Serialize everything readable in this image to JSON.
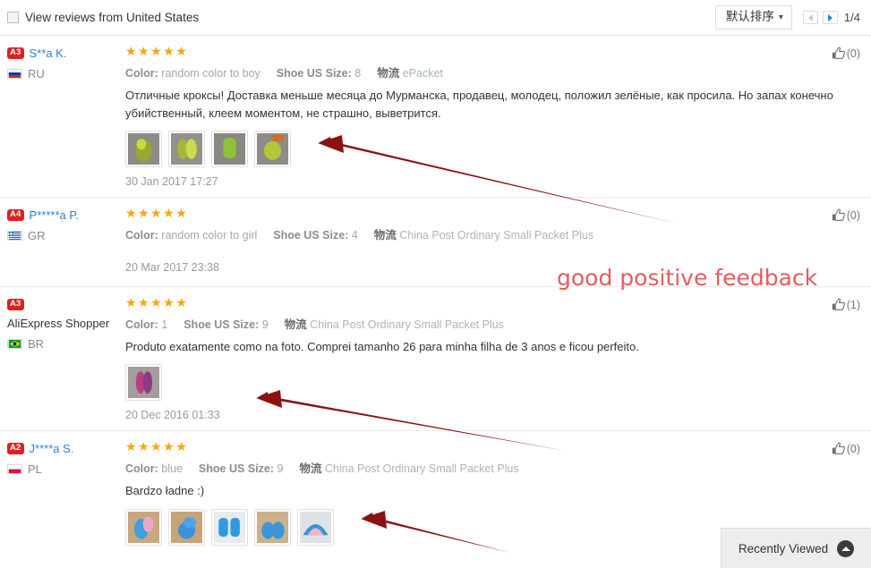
{
  "topbar": {
    "country_filter_label": "View reviews from United States",
    "country_filter_checked": false,
    "sort_label": "默认排序",
    "sort_chevron": "chevron-down-icon",
    "prev_label": "prev-page",
    "next_label": "next-page",
    "page_indicator": "1/4"
  },
  "reviews": [
    {
      "badge": "A3",
      "username": "S**a K.",
      "username_is_link": true,
      "country_code": "RU",
      "flag": "russia-flag",
      "stars": "★★★★★",
      "rating": 5,
      "color_key": "Color:",
      "color_value": "random color to boy",
      "size_key": "Shoe US Size:",
      "size_value": "8",
      "logistics_key": "物流",
      "logistics_value": "ePacket",
      "text": "Отличные кроксы! Доставка меньше месяца до Мурманска, продавец, молодец, положил зелёные, как просила. Но запах конечно убийственный, клеем моментом, не страшно, выветрится.",
      "photos": 4,
      "photo_theme": "green-shoes",
      "date": "30 Jan 2017 17:27",
      "helpful_count": "(0)"
    },
    {
      "badge": "A4",
      "username": "P*****a P.",
      "username_is_link": true,
      "country_code": "GR",
      "flag": "greece-flag",
      "stars": "★★★★★",
      "rating": 5,
      "color_key": "Color:",
      "color_value": "random color to girl",
      "size_key": "Shoe US Size:",
      "size_value": "4",
      "logistics_key": "物流",
      "logistics_value": "China Post Ordinary Small Packet Plus",
      "text": "",
      "photos": 0,
      "photo_theme": "",
      "date": "20 Mar 2017 23:38",
      "helpful_count": "(0)"
    },
    {
      "badge": "A3",
      "username": "AliExpress Shopper",
      "username_is_link": false,
      "country_code": "BR",
      "flag": "brazil-flag",
      "stars": "★★★★★",
      "rating": 5,
      "color_key": "Color:",
      "color_value": "1",
      "size_key": "Shoe US Size:",
      "size_value": "9",
      "logistics_key": "物流",
      "logistics_value": "China Post Ordinary Small Packet Plus",
      "text": "Produto exatamente como na foto. Comprei tamanho 26 para minha filha de 3 anos e ficou perfeito.",
      "photos": 1,
      "photo_theme": "pink-shoes",
      "date": "20 Dec 2016 01:33",
      "helpful_count": "(1)"
    },
    {
      "badge": "A2",
      "username": "J****a S.",
      "username_is_link": true,
      "country_code": "PL",
      "flag": "poland-flag",
      "stars": "★★★★★",
      "rating": 5,
      "color_key": "Color:",
      "color_value": "blue",
      "size_key": "Shoe US Size:",
      "size_value": "9",
      "logistics_key": "物流",
      "logistics_value": "China Post Ordinary Small Packet Plus",
      "text": "Bardzo ładne :)",
      "photos": 5,
      "photo_theme": "blue-shoes",
      "date": "",
      "helpful_count": "(0)"
    }
  ],
  "annotations": {
    "text_note": "good positive feedback",
    "note_color": "#e55c5c",
    "arrow_color": "#8b1212",
    "arrow_count": 3
  },
  "recently_viewed": {
    "label": "Recently Viewed",
    "icon": "chevron-up-circle-icon"
  }
}
